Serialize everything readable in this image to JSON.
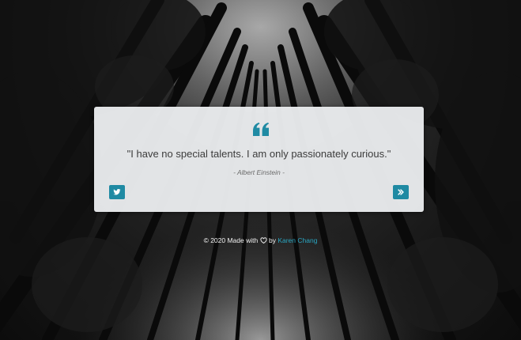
{
  "background": {
    "description_icon": "forest-trees-background"
  },
  "colors": {
    "accent": "#1f8aa3",
    "link": "#2aa6c2",
    "card": "#e8eaec",
    "quote_icon": "#1f8aa3"
  },
  "quote": {
    "icon": "quote-left-icon",
    "text": "\"I have no special talents. I am only passionately curious.\"",
    "author": "- Albert Einstein -"
  },
  "buttons": {
    "tweet_icon": "twitter-icon",
    "next_icon": "angle-double-right-icon"
  },
  "footer": {
    "prefix": "© 2020 Made with",
    "heart_icon": "heart-icon",
    "by": "by",
    "author_link": "Karen Chang"
  }
}
